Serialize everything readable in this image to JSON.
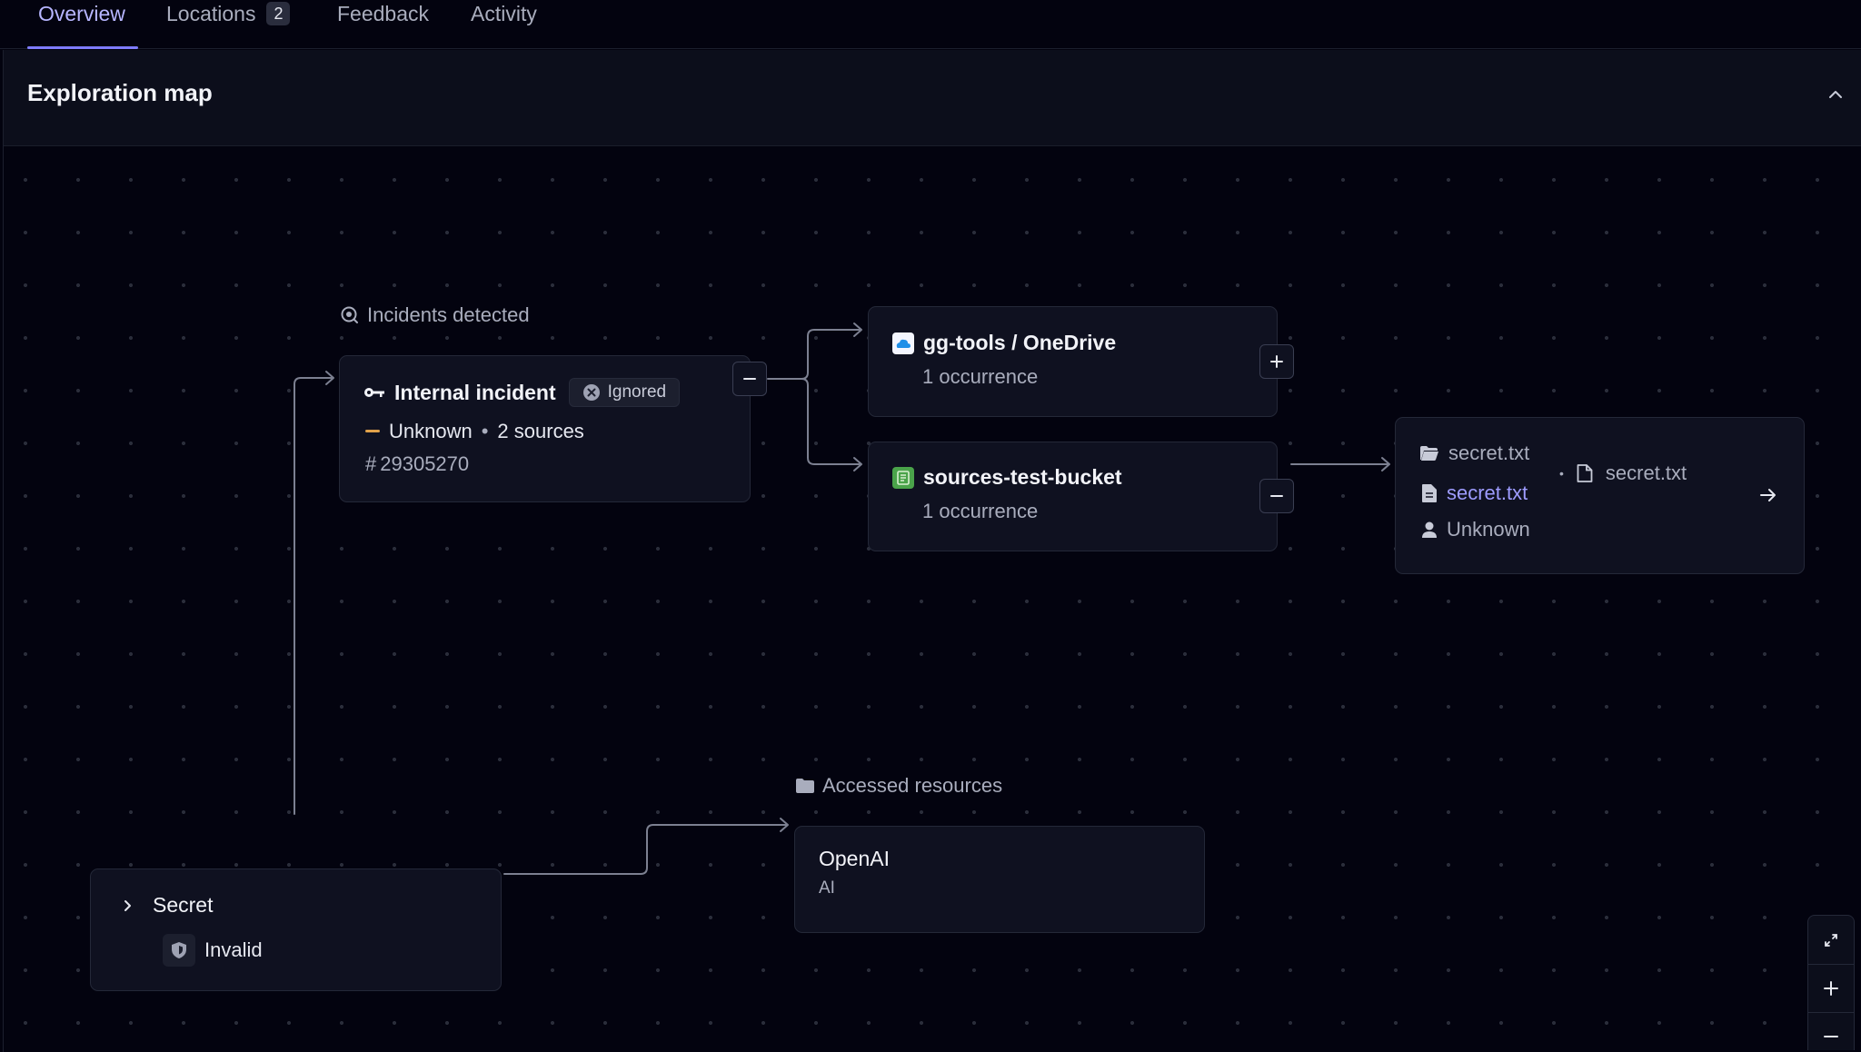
{
  "tabs": [
    {
      "label": "Overview",
      "active": true
    },
    {
      "label": "Locations",
      "badge": "2"
    },
    {
      "label": "Feedback"
    },
    {
      "label": "Activity"
    }
  ],
  "panel": {
    "title": "Exploration map"
  },
  "incidents_section": {
    "label": "Incidents detected"
  },
  "incident": {
    "title": "Internal incident",
    "status": "Ignored",
    "severity": "Unknown",
    "sources": "2 sources",
    "hash": "#",
    "id": "29305270"
  },
  "sources": [
    {
      "name": "gg-tools / OneDrive",
      "occurrences": "1 occurrence",
      "icon": "onedrive-icon",
      "expanded": false
    },
    {
      "name": "sources-test-bucket",
      "occurrences": "1 occurrence",
      "icon": "bucket-icon",
      "expanded": true
    }
  ],
  "file_node": {
    "folder": "secret.txt",
    "file_link": "secret.txt",
    "file": "secret.txt",
    "author": "Unknown"
  },
  "secret_node": {
    "title": "Secret",
    "validity": "Invalid"
  },
  "resources_section": {
    "label": "Accessed resources"
  },
  "resource": {
    "name": "OpenAI",
    "type": "AI"
  },
  "colors": {
    "accent": "#7f7cff",
    "link": "#9e9cff",
    "severity_unknown": "#e0a14a",
    "background": "#03030f",
    "node": "#0f1120"
  }
}
